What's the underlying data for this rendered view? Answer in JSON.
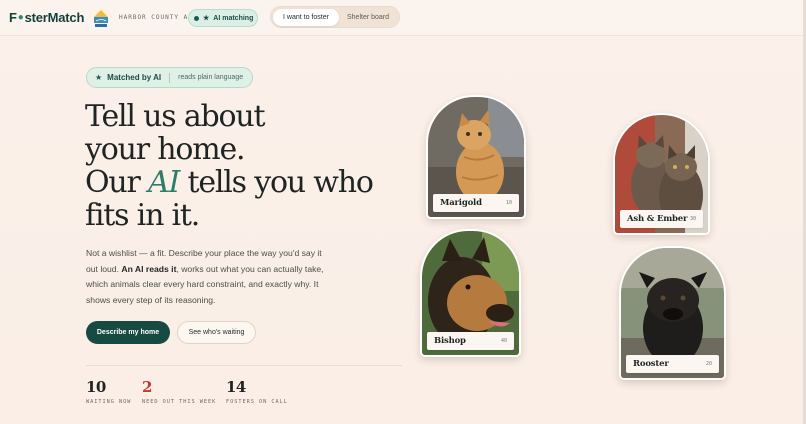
{
  "header": {
    "brand_left": "F",
    "brand_right": "sterMatch",
    "county": "HARBOR COUNTY AC",
    "ai_pill": "AI matching",
    "tabs": [
      {
        "label": "I want to foster",
        "active": true
      },
      {
        "label": "Shelter board",
        "active": false
      }
    ]
  },
  "hero": {
    "badge_strong": "Matched by AI",
    "badge_soft": "reads plain language",
    "headline": {
      "line1": "Tell us about",
      "line2": "your home.",
      "line3_pre": "Our ",
      "line3_ai": "AI",
      "line3_post": " tells you who",
      "line4": "fits in it."
    },
    "lede": {
      "part1": "Not a wishlist — a fit. Describe your place the way you'd say it out loud. ",
      "bold": "An AI reads it",
      "part2": ", works out what you can actually take, which animals clear every hard constraint, and exactly why. It shows every step of its reasoning."
    },
    "cta_primary": "Describe my home",
    "cta_secondary": "See who's waiting"
  },
  "stats": [
    {
      "value": "10",
      "label": "WAITING NOW"
    },
    {
      "value": "2",
      "label": "NEED OUT THIS WEEK"
    },
    {
      "value": "14",
      "label": "FOSTERS ON CALL"
    }
  ],
  "animals": [
    {
      "name": "Marigold",
      "id": "10"
    },
    {
      "name": "Ash & Ember",
      "id": "30"
    },
    {
      "name": "Bishop",
      "id": "40"
    },
    {
      "name": "Rooster",
      "id": "20"
    }
  ],
  "colors": {
    "brand": "#174a41",
    "accent": "#2d7d69",
    "urgent": "#c0392b",
    "background": "#faeee6"
  }
}
